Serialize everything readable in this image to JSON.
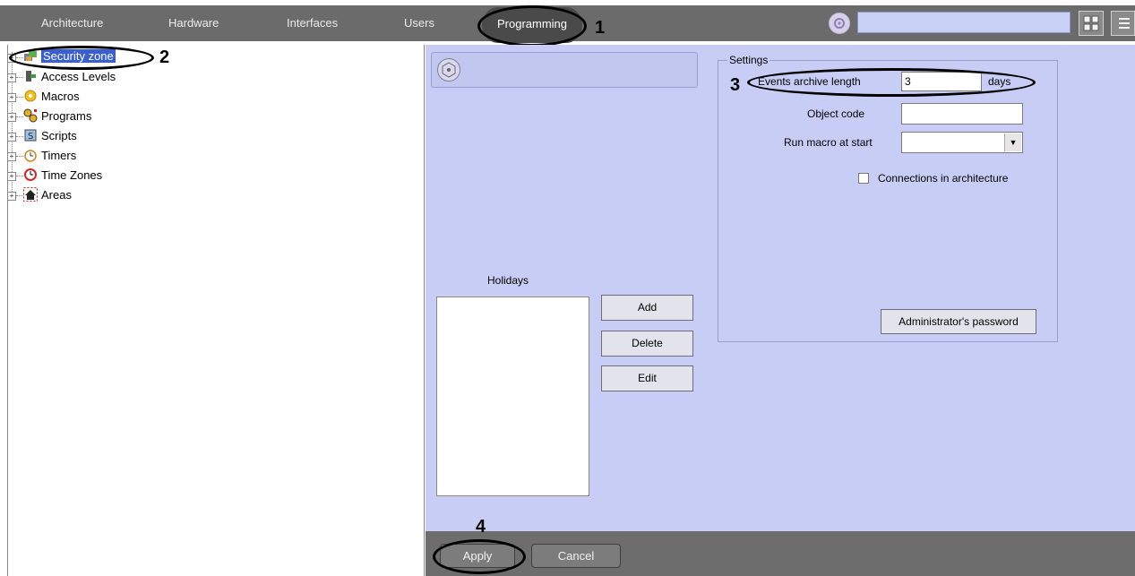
{
  "menu": {
    "items": [
      "Architecture",
      "Hardware",
      "Interfaces",
      "Users"
    ],
    "active": "Programming"
  },
  "tree": {
    "items": [
      {
        "label": "Security zone",
        "icon": "security-zone-icon",
        "selected": true
      },
      {
        "label": "Access Levels",
        "icon": "access-levels-icon"
      },
      {
        "label": "Macros",
        "icon": "macros-icon"
      },
      {
        "label": "Programs",
        "icon": "programs-icon"
      },
      {
        "label": "Scripts",
        "icon": "scripts-icon"
      },
      {
        "label": "Timers",
        "icon": "timers-icon"
      },
      {
        "label": "Time Zones",
        "icon": "time-zones-icon"
      },
      {
        "label": "Areas",
        "icon": "areas-icon"
      }
    ]
  },
  "settings": {
    "legend": "Settings",
    "events_archive_label": "Events archive length",
    "events_archive_value": "3",
    "events_archive_unit": "days",
    "object_code_label": "Object code",
    "object_code_value": "",
    "run_macro_label": "Run macro at start",
    "run_macro_value": "",
    "connections_label": "Connections in architecture",
    "connections_checked": false,
    "admin_password_label": "Administrator's password"
  },
  "holidays": {
    "label": "Holidays",
    "add_label": "Add",
    "delete_label": "Delete",
    "edit_label": "Edit"
  },
  "footer": {
    "apply_label": "Apply",
    "cancel_label": "Cancel"
  },
  "annotations": [
    "1",
    "2",
    "3",
    "4"
  ],
  "colors": {
    "menubar": "#6b6b6b",
    "panel": "#c8cdf5",
    "selection": "#3a5fd0"
  }
}
